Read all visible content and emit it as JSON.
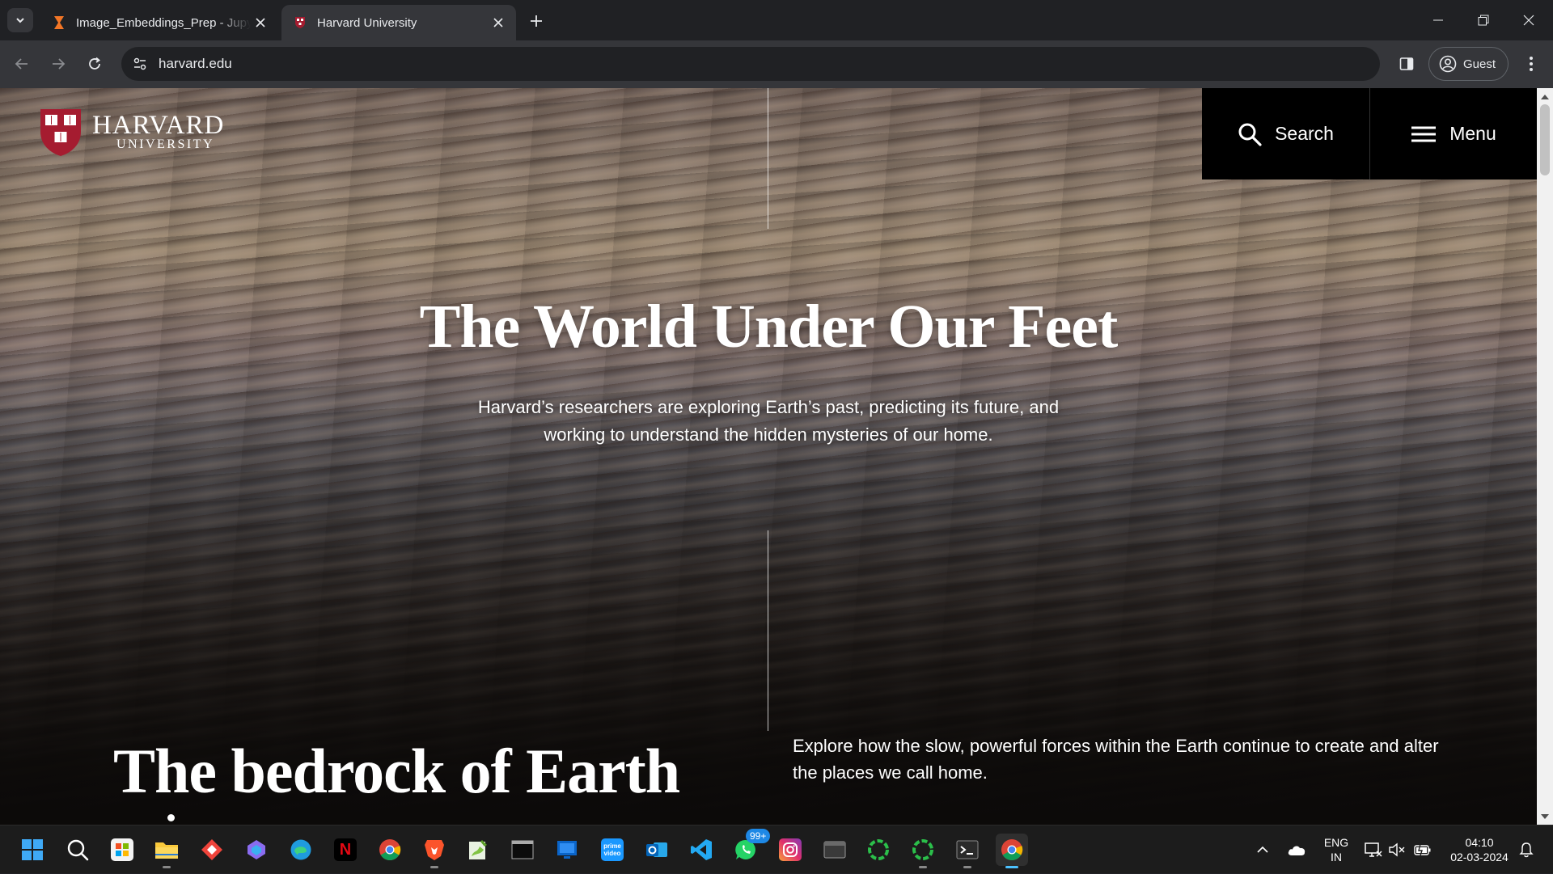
{
  "browser": {
    "tabs": [
      {
        "title": "Image_Embeddings_Prep - Jupy",
        "favicon": "hourglass-icon",
        "active": false
      },
      {
        "title": "Harvard University",
        "favicon": "harvard-shield-icon",
        "active": true
      }
    ],
    "url": "harvard.edu",
    "profile_label": "Guest"
  },
  "page": {
    "logo": {
      "line1": "HARVARD",
      "line2": "UNIVERSITY"
    },
    "header": {
      "search_label": "Search",
      "menu_label": "Menu"
    },
    "hero": {
      "title": "The World Under Our Feet",
      "subtitle": "Harvard’s researchers are exploring Earth’s past, predicting its future, and working to understand the hidden mysteries of our home."
    },
    "section": {
      "title": "The bedrock of Earth",
      "description": "Explore how the slow, powerful forces within the Earth continue to create and alter the places we call home."
    }
  },
  "taskbar": {
    "apps": [
      "windows-start",
      "search",
      "store",
      "file-explorer",
      "anydesk",
      "copilot",
      "edge",
      "netflix",
      "chrome",
      "brave",
      "notepad-plus",
      "terminal-cmd",
      "windows-app",
      "prime-video",
      "outlook",
      "vscode",
      "whatsapp",
      "instagram",
      "folder-window",
      "spinner-app",
      "spinner-app-2",
      "terminal",
      "chrome-active"
    ],
    "whatsapp_badge": "99+",
    "tray": {
      "language_line1": "ENG",
      "language_line2": "IN",
      "time": "04:10",
      "date": "02-03-2024"
    }
  },
  "colors": {
    "chrome_dark": "#202124",
    "chrome_toolbar": "#35363a",
    "harvard_crimson": "#a51c30",
    "taskbar": "#1c1c1c"
  }
}
